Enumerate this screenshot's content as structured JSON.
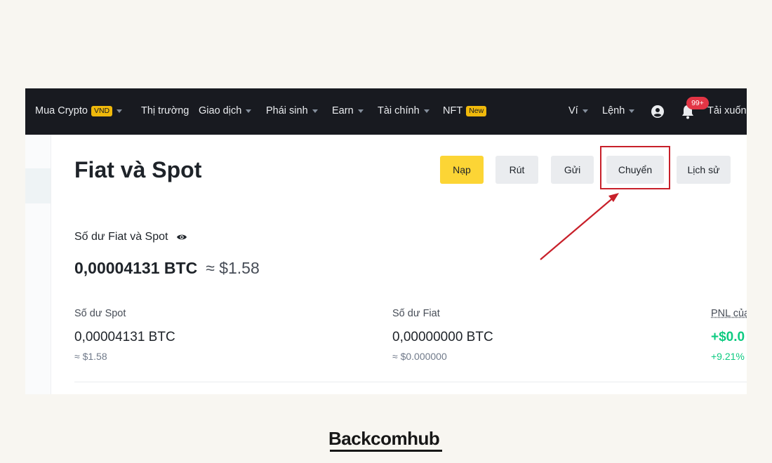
{
  "nav": {
    "items": [
      {
        "label": "Mua Crypto",
        "badge": "VND",
        "caret": true
      },
      {
        "label": "Thị trường",
        "caret": false
      },
      {
        "label": "Giao dịch",
        "caret": true
      },
      {
        "label": "Phái sinh",
        "caret": true
      },
      {
        "label": "Earn",
        "caret": true
      },
      {
        "label": "Tài chính",
        "caret": true
      },
      {
        "label": "NFT",
        "badge": "New",
        "caret": false
      }
    ],
    "right_items": [
      {
        "label": "Ví",
        "caret": true
      },
      {
        "label": "Lệnh",
        "caret": true
      }
    ],
    "notification_count": "99+",
    "download_label": "Tải xuống"
  },
  "page": {
    "title": "Fiat và Spot",
    "buttons": {
      "deposit": "Nạp",
      "withdraw": "Rút",
      "send": "Gửi",
      "transfer": "Chuyển",
      "history": "Lịch sử"
    }
  },
  "balance": {
    "label": "Số dư Fiat và Spot",
    "total_btc": "0,00004131 BTC",
    "total_usd": "≈ $1.58"
  },
  "columns": {
    "spot": {
      "label": "Số dư Spot",
      "value": "0,00004131 BTC",
      "sub": "≈ $1.58"
    },
    "fiat": {
      "label": "Số dư Fiat",
      "value": "0,00000000 BTC",
      "sub": "≈ $0.000000"
    },
    "pnl": {
      "label": "PNL của",
      "value": "+$0.0",
      "sub": "+9.21%"
    }
  },
  "colors": {
    "topbar": "#181a20",
    "accent": "#fcd535",
    "highlight": "#c8202a",
    "positive": "#0ecb81"
  },
  "logo": {
    "text": "Backcomhub"
  }
}
